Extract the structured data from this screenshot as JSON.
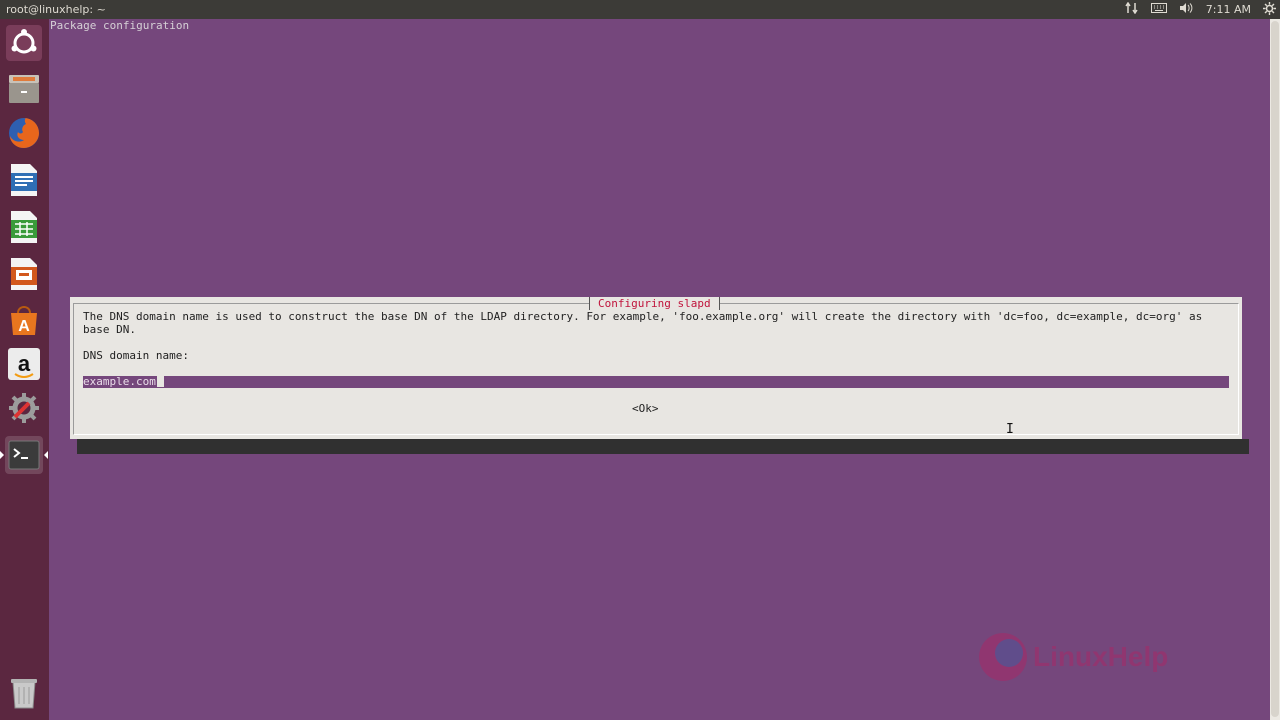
{
  "top_panel": {
    "window_title": "root@linuxhelp: ~",
    "time": "7:11 AM"
  },
  "launcher": {
    "items": [
      {
        "name": "ubuntu-dash"
      },
      {
        "name": "files"
      },
      {
        "name": "firefox"
      },
      {
        "name": "libreoffice-writer"
      },
      {
        "name": "libreoffice-calc"
      },
      {
        "name": "libreoffice-impress"
      },
      {
        "name": "ubuntu-software-center"
      },
      {
        "name": "amazon"
      },
      {
        "name": "system-settings"
      },
      {
        "name": "terminal"
      },
      {
        "name": "trash"
      }
    ]
  },
  "terminal": {
    "header": "Package configuration"
  },
  "dialog": {
    "title": "Configuring slapd",
    "description": "The DNS domain name is used to construct the base DN of the LDAP directory. For example, 'foo.example.org' will create the directory with 'dc=foo, dc=example, dc=org' as\nbase DN.",
    "label": "DNS domain name:",
    "input_value": "example.com",
    "ok_label": "<Ok>"
  },
  "watermark": {
    "text": "LinuxHelp"
  },
  "colors": {
    "terminal_bg": "#75477c",
    "dialog_bg": "#e8e6e2",
    "title_red": "#c0143c",
    "launcher_bg": "#5b2740",
    "panel_bg": "#3c3b37"
  }
}
